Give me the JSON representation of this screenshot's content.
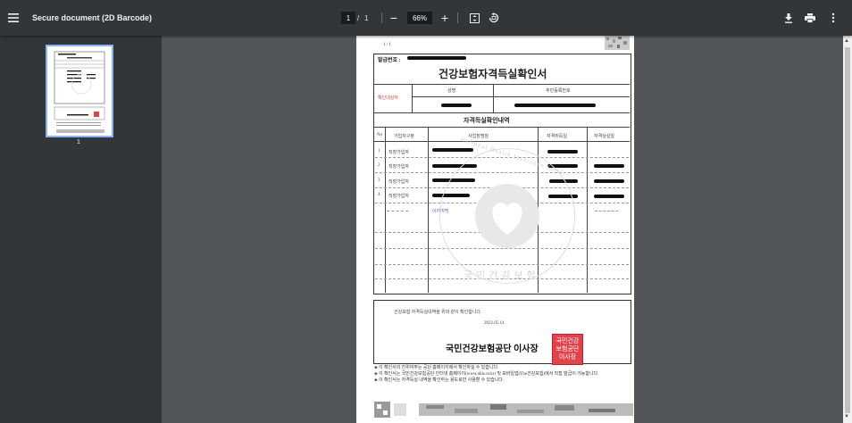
{
  "toolbar": {
    "title": "Secure document (2D Barcode)",
    "current_page": "1",
    "page_separator": "/",
    "total_pages": "1",
    "zoom": "66%",
    "zoom_out_symbol": "−",
    "zoom_in_symbol": "+"
  },
  "sidebar": {
    "thumbnail_page_label": "1"
  },
  "document": {
    "page_indicator": "1 / 1",
    "issue_number_label": "발급번호 :",
    "main_title": "건강보험자격득실확인서",
    "person_label": "확인대상자",
    "name_header": "성명",
    "id_header": "주민등록번호",
    "section_title": "자격득실확인내역",
    "table_headers": [
      "No",
      "가입자구분",
      "사업장명칭",
      "자격취득일",
      "자격상실일"
    ],
    "rows": [
      {
        "no": "1",
        "type": "직장가입자"
      },
      {
        "no": "2",
        "type": "직장가입자"
      },
      {
        "no": "3",
        "type": "직장가입자"
      },
      {
        "no": "4",
        "type": "직장가입자"
      }
    ],
    "blank_row_note": "이하여백",
    "certify_text": "건강보험 자격득실내역을 위와 같이 확인합니다.",
    "date": "2022.05.14",
    "issuer": "국민건강보험공단 이사장",
    "seal_text": "국민건강보험공단이사장",
    "watermark_text": "National Health Insurance Service",
    "watermark_korean": "국민건강보험",
    "notes": [
      "이 확인서의 진위여부는 공단 홈페이지에서 확인하실 수 있습니다.",
      "이 확인서는 국민건강보험공단 인터넷 홈페이지(www.nhis.or.kr) 및 모바일앱(The건강보험)에서 직접 발급이 가능합니다.",
      "이 확인서는 자격득실 내역을 확인하는 용도로만 사용할 수 있습니다."
    ]
  }
}
